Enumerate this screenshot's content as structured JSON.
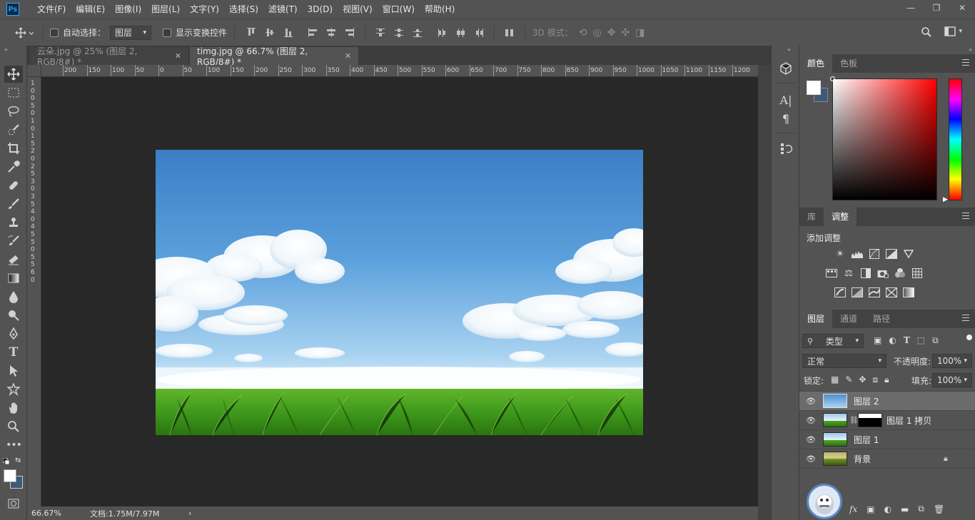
{
  "app": {
    "logo": "Ps"
  },
  "menu": [
    "文件(F)",
    "编辑(E)",
    "图像(I)",
    "图层(L)",
    "文字(Y)",
    "选择(S)",
    "滤镜(T)",
    "3D(D)",
    "视图(V)",
    "窗口(W)",
    "帮助(H)"
  ],
  "window_controls": {
    "minimize": "—",
    "restore": "❐",
    "close": "✕"
  },
  "options": {
    "auto_select_label": "自动选择：",
    "auto_select_value": "图层",
    "show_transform_label": "显示变换控件",
    "mode_3d_label": "3D 模式："
  },
  "tabs": [
    {
      "label": "云朵.jpg @ 25% (图层 2, RGB/8#) *",
      "close": "✕"
    },
    {
      "label": "timg.jpg @ 66.7% (图层 2, RGB/8#) *",
      "close": "✕"
    }
  ],
  "ruler_top": [
    "200",
    "150",
    "100",
    "50",
    "0",
    "50",
    "100",
    "150",
    "200",
    "250",
    "300",
    "350",
    "400",
    "450",
    "500",
    "550",
    "600",
    "650",
    "700",
    "750",
    "800",
    "850",
    "900",
    "950",
    "1000",
    "1050",
    "1100",
    "1150",
    "1200"
  ],
  "ruler_left": [
    "1",
    "0",
    "0",
    "5",
    "0",
    "1",
    "0",
    "1",
    "5",
    "2",
    "0",
    "2",
    "5",
    "3",
    "0",
    "3",
    "5",
    "4",
    "0",
    "4",
    "5",
    "5",
    "0",
    "5",
    "5",
    "6",
    "0"
  ],
  "status": {
    "zoom": "66.67%",
    "doc": "文档:1.75M/7.97M",
    "arrow": "›"
  },
  "panels": {
    "color_tabs": [
      "颜色",
      "色板"
    ],
    "adjust_tabs": [
      "库",
      "调整"
    ],
    "adjust_title": "添加调整",
    "layers_tabs": [
      "图层",
      "通道",
      "路径"
    ],
    "filter_kind": "类型",
    "blend_mode": "正常",
    "opacity_label": "不透明度:",
    "opacity_value": "100%",
    "lock_label": "锁定:",
    "fill_label": "填充:",
    "fill_value": "100%",
    "layers": [
      {
        "name": "图层 2",
        "selected": true
      },
      {
        "name": "图层 1 拷贝",
        "selected": false
      },
      {
        "name": "图层 1",
        "selected": false
      },
      {
        "name": "背景",
        "selected": false
      }
    ],
    "fx_label": "fx"
  },
  "colors": {
    "foreground": "#ffffff",
    "background": "#3d5a78",
    "hue_base": "#ff0000",
    "accent": "#31a8ff"
  }
}
